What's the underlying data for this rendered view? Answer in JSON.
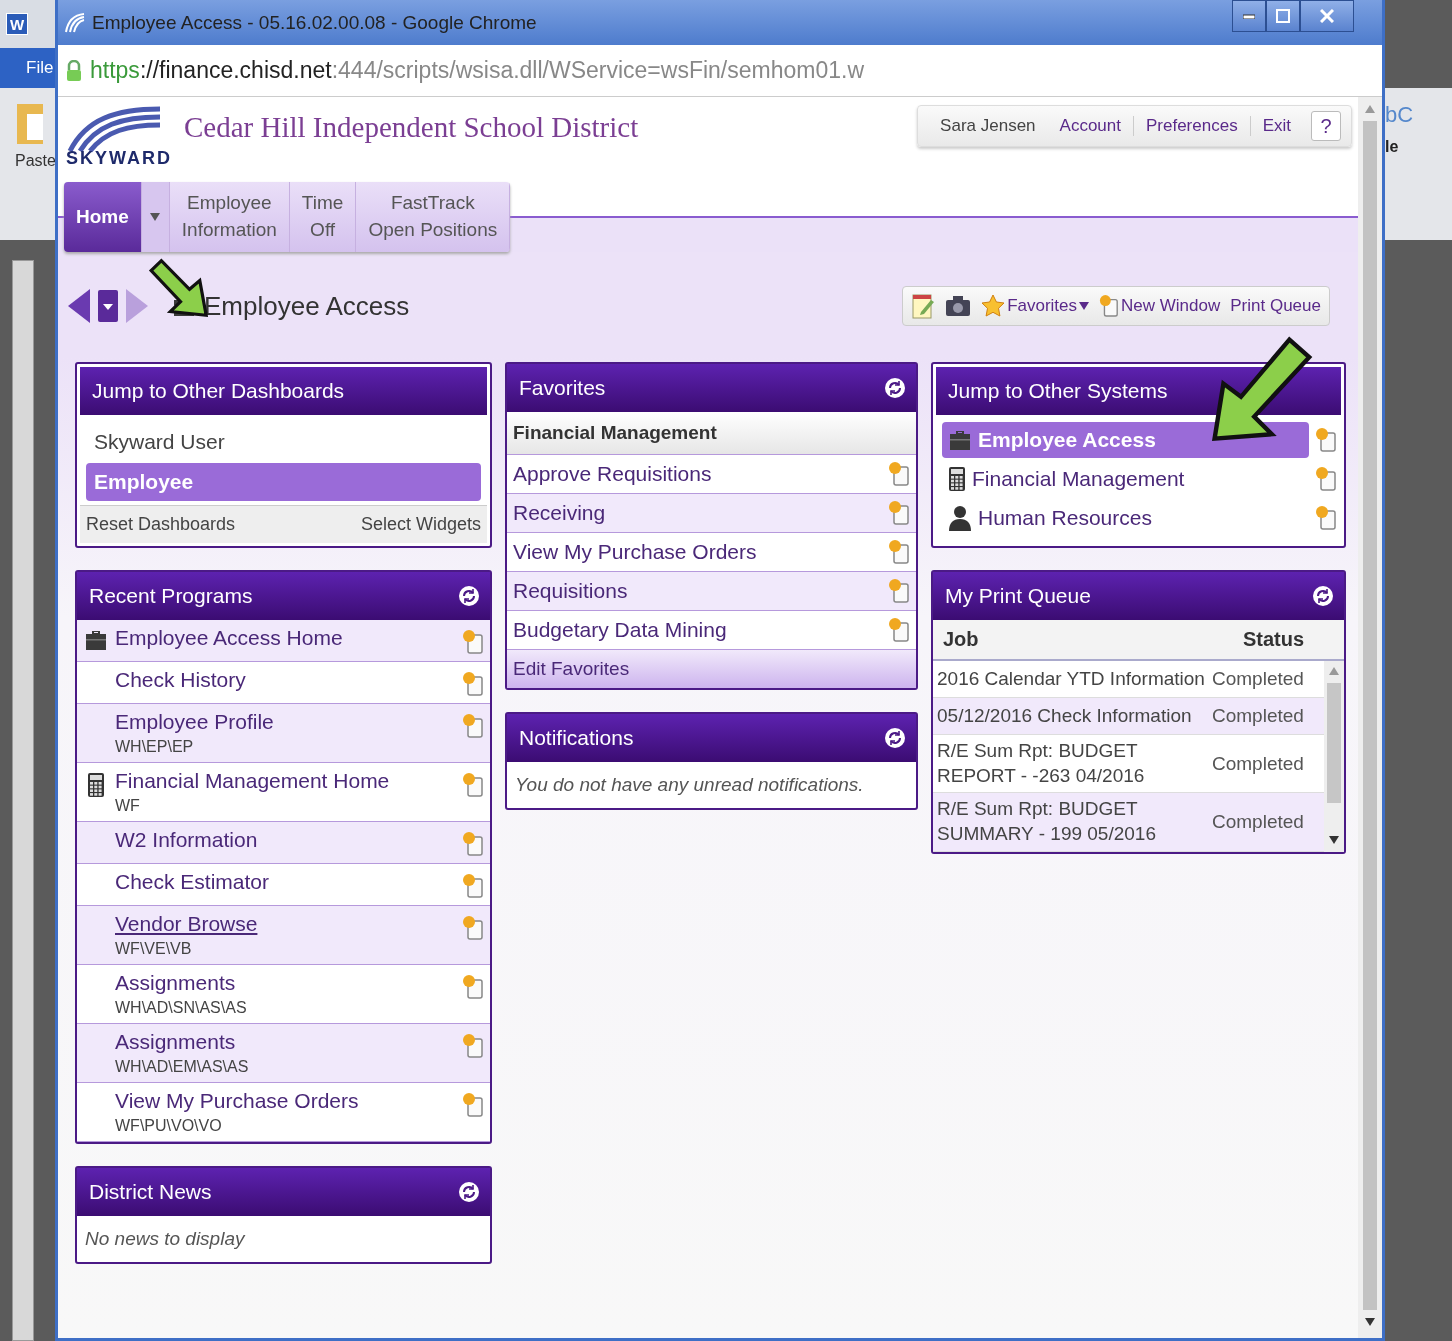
{
  "word": {
    "app_icon": "W",
    "file_tab": "File",
    "paste": "Paste",
    "style_preview": [
      "bC",
      "le"
    ]
  },
  "browser": {
    "title": "Employee Access - 05.16.02.00.08 - Google Chrome",
    "url": {
      "scheme": "https",
      "host": "://finance.chisd.net",
      "path": ":444/scripts/wsisa.dll/WService=wsFin/semhom01.w"
    }
  },
  "header": {
    "logo_text": "SKYWARD",
    "district": "Cedar Hill Independent School District",
    "user_menu": [
      {
        "label": "Sara Jensen",
        "kind": "name"
      },
      {
        "label": "Account",
        "kind": "link"
      },
      {
        "label": "Preferences",
        "kind": "link"
      },
      {
        "label": "Exit",
        "kind": "link"
      },
      {
        "label": "?",
        "kind": "help"
      }
    ]
  },
  "nav_tabs": [
    {
      "lines": [
        "Home"
      ],
      "selected": true,
      "has_menu": true
    },
    {
      "lines": [
        "Employee",
        "Information"
      ],
      "selected": false,
      "has_menu": false
    },
    {
      "lines": [
        "Time",
        "Off"
      ],
      "selected": false,
      "has_menu": false
    },
    {
      "lines": [
        "FastTrack",
        "Open Positions"
      ],
      "selected": false,
      "has_menu": false
    }
  ],
  "breadcrumb": {
    "title": "Employee Access"
  },
  "toolbar": [
    {
      "kind": "notes"
    },
    {
      "kind": "camera"
    },
    {
      "kind": "favorites",
      "label": "Favorites"
    },
    {
      "kind": "new-window",
      "label": "New Window"
    },
    {
      "kind": "link",
      "label": "Print Queue"
    }
  ],
  "dashboards": {
    "title": "Jump to Other Dashboards",
    "items": [
      {
        "label": "Skyward User",
        "selected": false
      },
      {
        "label": "Employee",
        "selected": true
      }
    ],
    "footer": [
      "Reset Dashboards",
      "Select Widgets"
    ]
  },
  "recent_programs": {
    "title": "Recent Programs",
    "items": [
      {
        "label": "Employee Access Home",
        "kind": "briefcase",
        "hovered": false
      },
      {
        "label": "Check History",
        "hovered": false
      },
      {
        "label": "Employee Profile",
        "path": "WH\\EP\\EP",
        "hovered": false
      },
      {
        "label": "Financial Management Home",
        "path": "WF",
        "kind": "calculator",
        "hovered": false
      },
      {
        "label": "W2 Information",
        "hovered": false
      },
      {
        "label": "Check Estimator",
        "hovered": false
      },
      {
        "label": "Vendor Browse",
        "path": "WF\\VE\\VB",
        "hovered": true
      },
      {
        "label": "Assignments",
        "path": "WH\\AD\\SN\\AS\\AS",
        "hovered": false
      },
      {
        "label": "Assignments",
        "path": "WH\\AD\\EM\\AS\\AS",
        "hovered": false
      },
      {
        "label": "View My Purchase Orders",
        "path": "WF\\PU\\VO\\VO",
        "hovered": false
      }
    ]
  },
  "district_news": {
    "title": "District News",
    "message": "No news to display"
  },
  "favorites": {
    "title": "Favorites",
    "group": "Financial Management",
    "items": [
      "Approve Requisitions",
      "Receiving",
      "View My Purchase Orders",
      "Requisitions",
      "Budgetary Data Mining"
    ],
    "footer": "Edit Favorites"
  },
  "notifications": {
    "title": "Notifications",
    "message": "You do not have any unread notifications."
  },
  "other_systems": {
    "title": "Jump to Other Systems",
    "items": [
      {
        "label": "Employee Access",
        "kind": "briefcase",
        "selected": true
      },
      {
        "label": "Financial Management",
        "kind": "calculator",
        "selected": false
      },
      {
        "label": "Human Resources",
        "kind": "person",
        "selected": false
      }
    ]
  },
  "print_queue": {
    "title": "My Print Queue",
    "columns": [
      "Job",
      "Status"
    ],
    "rows": [
      [
        "2016 Calendar YTD Information",
        "Completed"
      ],
      [
        "05/12/2016 Check Information",
        "Completed"
      ],
      [
        "R/E Sum Rpt: BUDGET REPORT - -263 04/2016",
        "Completed"
      ],
      [
        "R/E Sum Rpt: BUDGET SUMMARY - 199 05/2016",
        "Completed"
      ]
    ]
  }
}
